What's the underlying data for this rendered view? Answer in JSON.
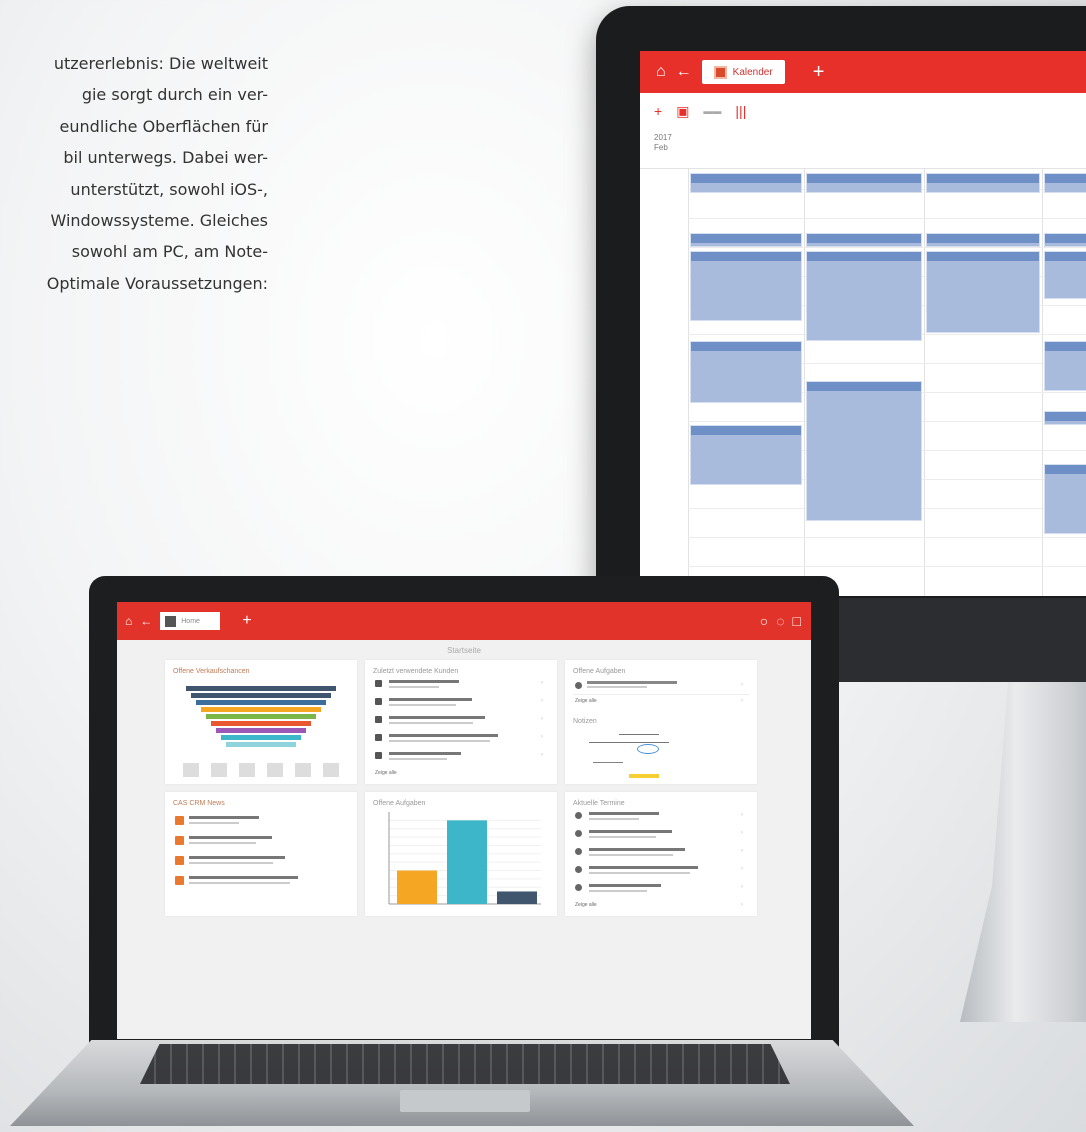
{
  "intro": {
    "lines": [
      "utzererlebnis: Die weltweit",
      "gie sorgt durch ein ver-",
      "eundliche Oberflächen für",
      "bil unterwegs. Dabei wer-",
      "unterstützt, sowohl iOS-,",
      "Windowssysteme. Gleiches",
      "sowohl am PC, am Note-",
      "Optimale Voraussetzungen:"
    ]
  },
  "monitor": {
    "tab_label": "Kalender",
    "year": "2017",
    "year_sub": "Feb",
    "colors": {
      "header": "#e8302b",
      "event": "#a9bbdc",
      "event_head": "#6f8fc7"
    }
  },
  "laptop": {
    "tab_label": "Home",
    "page_title": "Startseite",
    "cards": {
      "funnel": {
        "title": "Offene Verkaufschancen"
      },
      "contacts": {
        "title": "Zuletzt verwendete Kunden",
        "show_all": "Zeige alle"
      },
      "tasks_top": {
        "title": "Offene Aufgaben",
        "show_all": "Zeige alle"
      },
      "notes": {
        "title": "Notizen"
      },
      "news": {
        "title": "CAS CRM News"
      },
      "tasks_chart": {
        "title": "Offene Aufgaben"
      },
      "appointments": {
        "title": "Aktuelle Termine",
        "show_all": "Zeige alle"
      }
    }
  },
  "chart_data": {
    "type": "bar",
    "title": "Offene Aufgaben",
    "values": [
      4,
      10,
      1.5
    ],
    "ylim": [
      0,
      11
    ],
    "colors": [
      "#f5a623",
      "#3cb6c8",
      "#3f566e"
    ]
  }
}
